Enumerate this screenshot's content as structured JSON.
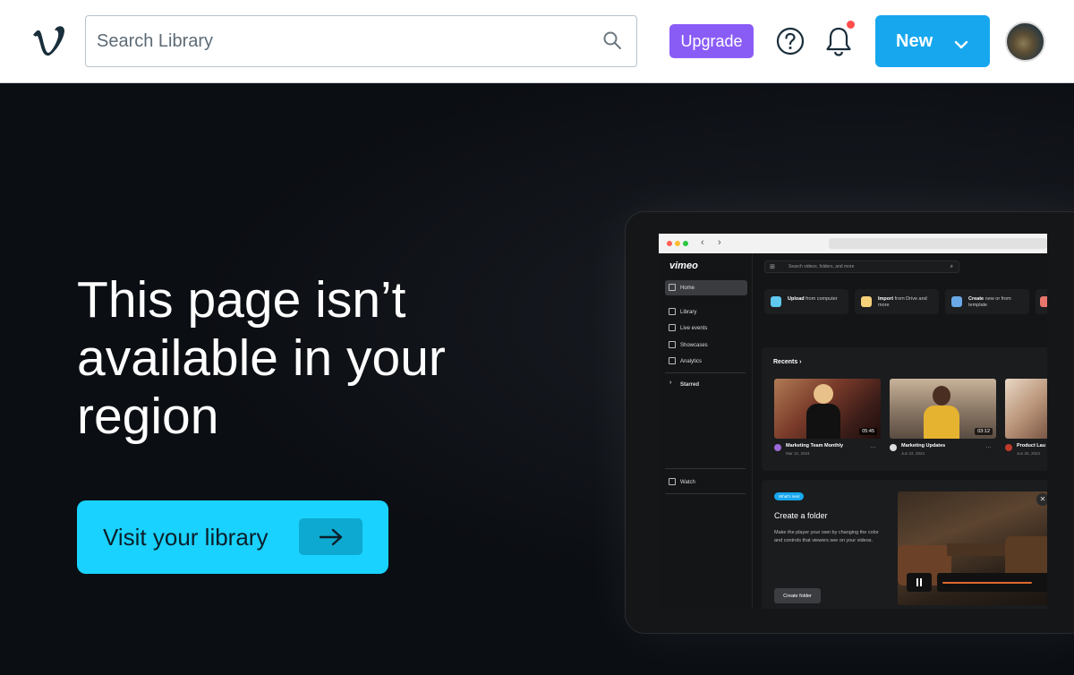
{
  "header": {
    "search_placeholder": "Search Library",
    "upgrade_label": "Upgrade",
    "new_label": "New",
    "notification_dot": true
  },
  "hero": {
    "headline": "This page isn’t available in your region",
    "cta_label": "Visit your library"
  },
  "mockup": {
    "brand": "vimeo",
    "search_placeholder": "Search videos, folders, and more",
    "sidebar": [
      {
        "label": "Home",
        "active": true
      },
      {
        "label": "Library"
      },
      {
        "label": "Live events"
      },
      {
        "label": "Showcases"
      },
      {
        "label": "Analytics"
      },
      {
        "label": "Starred"
      },
      {
        "label": "Watch"
      }
    ],
    "quick_actions": [
      {
        "bold": "Upload",
        "rest": " from computer"
      },
      {
        "bold": "Import",
        "rest": " from Drive and more"
      },
      {
        "bold": "Create",
        "rest": " new or from template"
      }
    ],
    "recents_title": "Recents",
    "videos": [
      {
        "title": "Marketing Team Monthly",
        "date": "Mar 12, 2024",
        "duration": "05:45"
      },
      {
        "title": "Marketing Updates",
        "date": "Jun 22, 2024",
        "duration": "03:12"
      },
      {
        "title": "Product Lau",
        "date": "Jun 26, 2024",
        "duration": ""
      }
    ],
    "promo": {
      "badge": "What's next",
      "title": "Create a folder",
      "description": "Make the player your own by changing the color and controls that viewers see on your videos.",
      "button": "Create folder",
      "progress": 0.78
    }
  },
  "colors": {
    "accent_blue": "#17a7ee",
    "cta_cyan": "#19d2ff",
    "upgrade_purple": "#8a5cf6",
    "notification_red": "#ff4d4d",
    "background": "#0b0e13"
  }
}
